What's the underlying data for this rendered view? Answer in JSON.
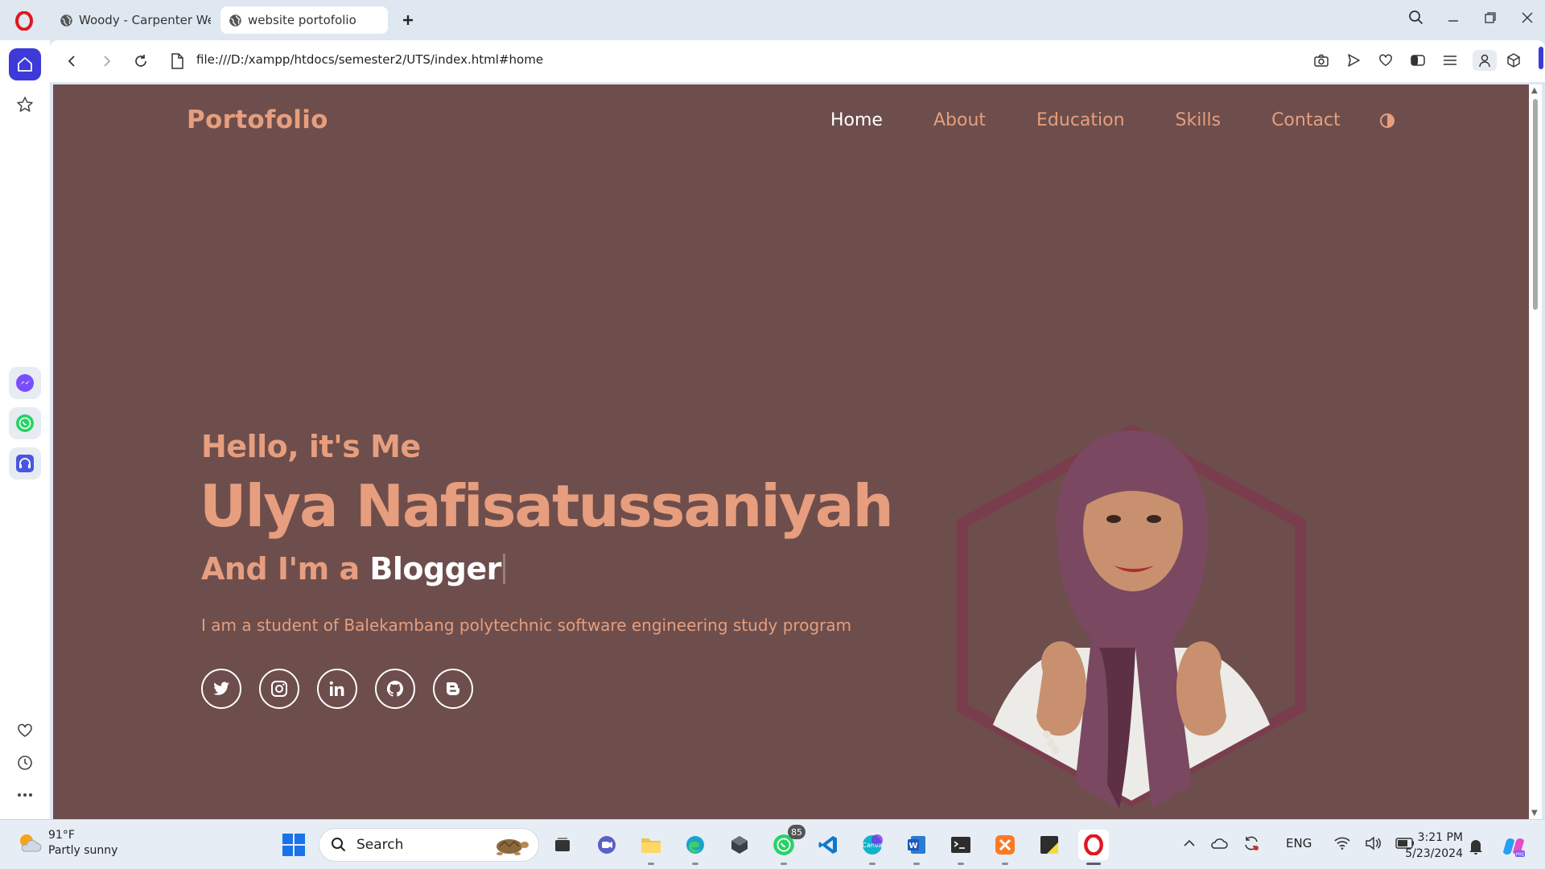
{
  "browser": {
    "tabs": [
      {
        "title": "Woody - Carpenter Websi",
        "active": false
      },
      {
        "title": "website portofolio",
        "active": true
      }
    ],
    "url": "file:///D:/xampp/htdocs/semester2/UTS/index.html#home"
  },
  "site": {
    "logo": "Portofolio",
    "nav": [
      {
        "label": "Home",
        "active": true
      },
      {
        "label": "About",
        "active": false
      },
      {
        "label": "Education",
        "active": false
      },
      {
        "label": "Skills",
        "active": false
      },
      {
        "label": "Contact",
        "active": false
      }
    ],
    "hero": {
      "intro": "Hello, it's Me",
      "name": "Ulya Nafisatussaniyah",
      "role_prefix": "And I'm a ",
      "role_word": "Blogger",
      "description": "I am a student of Balekambang polytechnic software engineering study program"
    },
    "socials": [
      "twitter-icon",
      "instagram-icon",
      "linkedin-icon",
      "github-icon",
      "blogger-icon"
    ],
    "colors": {
      "background": "#6d4e4c",
      "accent": "#e79e7e",
      "highlight": "#ffffff",
      "hexagon": "#7a3d4e"
    }
  },
  "taskbar": {
    "weather_temp": "91°F",
    "weather_desc": "Partly sunny",
    "search_label": "Search",
    "whatsapp_badge": "85",
    "language": "ENG",
    "time": "3:21 PM",
    "date": "5/23/2024"
  }
}
